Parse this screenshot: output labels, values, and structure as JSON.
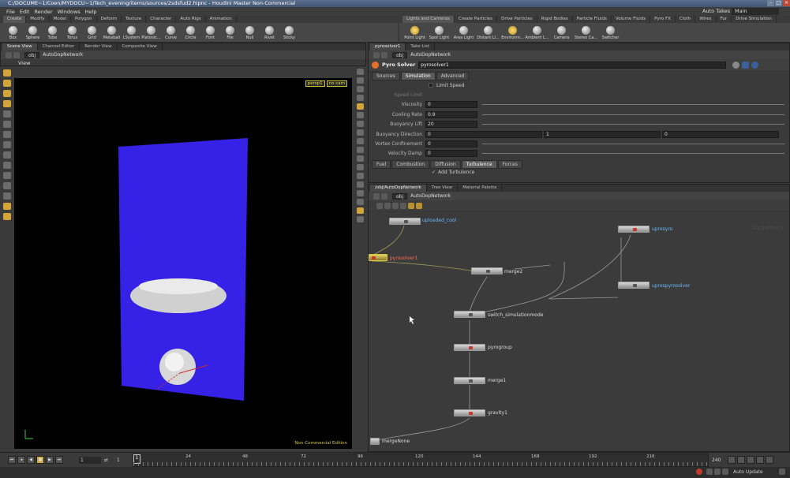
{
  "window": {
    "title": "C:/DOCUME~1/Coen/MYDOCU~1/Tech_evening/items/sources/2sdsfud2.hipnc - Houdini Master Non-Commercial"
  },
  "menu": {
    "items": [
      "File",
      "Edit",
      "Render",
      "Windows",
      "Help"
    ],
    "auto_takes": "Auto Takes",
    "desktop": "Main"
  },
  "shelf_left": {
    "tabs": [
      "Create",
      "Modify",
      "Model",
      "Polygon",
      "Deform",
      "Texture",
      "Character",
      "Auto Rigs",
      "Animation"
    ],
    "tools": [
      "Box",
      "Sphere",
      "Tube",
      "Torus",
      "Grid",
      "Metaball",
      "LSystem",
      "Platonic...",
      "Curve",
      "Circle",
      "Font",
      "File",
      "Null",
      "Rivet",
      "Sticky"
    ]
  },
  "shelf_right": {
    "tabs": [
      "Lights and Cameras",
      "Create Particles",
      "Drive Particles",
      "Rigid Bodies",
      "Particle Fluids",
      "Volume Fluids",
      "Pyro FX",
      "Cloth",
      "Wires",
      "Fur",
      "Drive Simulation"
    ],
    "tools": [
      "Point Light",
      "Spot Light",
      "Area Light",
      "Distant Li...",
      "Environm...",
      "Ambient L...",
      "Camera",
      "Stereo Ca...",
      "Switcher"
    ]
  },
  "scene_pane": {
    "tabs": [
      "Scene View",
      "Channel Editor",
      "Render View",
      "Composite View"
    ],
    "path_root": "obj",
    "path": "AutoDopNetwork",
    "view_label": "View",
    "persp": "persp1",
    "cam": "no cam",
    "edition": "Non-Commercial Edition"
  },
  "param_pane": {
    "tabs": [
      "pyrosolver1",
      "Take List"
    ],
    "path_root": "obj",
    "path": "AutoDopNetwork",
    "node_type": "Pyro Solver",
    "node_name": "pyrosolver1",
    "sub_tabs": [
      "Sources",
      "Simulation",
      "Advanced"
    ],
    "limit_speed": "Limit Speed",
    "speed_limit_label": "Speed Limit",
    "params": [
      {
        "label": "Viscosity",
        "value": "0"
      },
      {
        "label": "Cooling Rate",
        "value": "0.9"
      },
      {
        "label": "Buoyancy Lift",
        "value": "20"
      },
      {
        "label": "Buoyancy Direction",
        "value": "0",
        "value2": "1",
        "value3": "0"
      },
      {
        "label": "Vortex Confinement",
        "value": "0"
      },
      {
        "label": "Velocity Damp",
        "value": "0"
      }
    ],
    "bottom_tabs": [
      "Fuel",
      "Combustion",
      "Diffusion",
      "Turbulence",
      "Forces"
    ],
    "add_turbulence": "Add Turbulence"
  },
  "network_pane": {
    "tabs": [
      "/obj/AutoDopNetwork",
      "Tree View",
      "Material Palette"
    ],
    "path_root": "obj",
    "path": "AutoDopNetwork",
    "watermark": "Dynamics",
    "nodes": {
      "top": "uploaded_cool",
      "pyrosolver": "pyrosolver1",
      "merge2": "merge2",
      "upres": "upresyro",
      "upressolver": "uprespyrosolver",
      "switch": "switch_simulationmode",
      "pyrogroup": "pyrogroup",
      "merge1": "merge1",
      "gravity": "gravity1",
      "mergenone": "mergeNone"
    }
  },
  "timeline": {
    "start": "1",
    "current": "1",
    "frame_marker": "1",
    "end": "240",
    "ticks": [
      "24",
      "48",
      "72",
      "96",
      "120",
      "144",
      "168",
      "192",
      "216"
    ]
  },
  "status": {
    "auto_update": "Auto Update"
  }
}
